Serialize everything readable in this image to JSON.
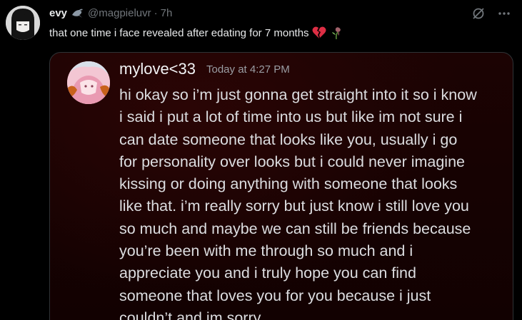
{
  "post": {
    "display_name": "evy",
    "handle": "@magpieluvr",
    "separator": "·",
    "time": "7h",
    "text": "that one time i face revealed after edating for 7 months",
    "emojis": [
      "broken-heart-emoji",
      "wilted-rose-emoji"
    ]
  },
  "message": {
    "sender": "mylove<33",
    "timestamp": "Today at 4:27 PM",
    "lines": [
      "hi okay so i’m just gonna get straight into it so i know",
      "i said i put a lot of time into us but like im not sure i",
      "can date someone that looks like you, usually i go",
      "for personality over looks but i could never imagine",
      "kissing or doing anything with someone that looks",
      "like that. i’m really sorry but just know i still love you",
      "so much and maybe we can still be friends because",
      "you’re been with me through so much and i",
      "appreciate you and i truly hope you can find",
      "someone that loves you for you because i just",
      "couldn’t and im sorry."
    ]
  },
  "colors": {
    "background": "#000000",
    "primary_text": "#e7e9ea",
    "secondary_text": "#71767b",
    "media_bg": "#160202",
    "dm_text": "#dcdde0",
    "dm_time": "#9a9da3"
  },
  "icons": {
    "badge": "bird-icon",
    "grok": "grok-icon",
    "more": "more-icon"
  }
}
